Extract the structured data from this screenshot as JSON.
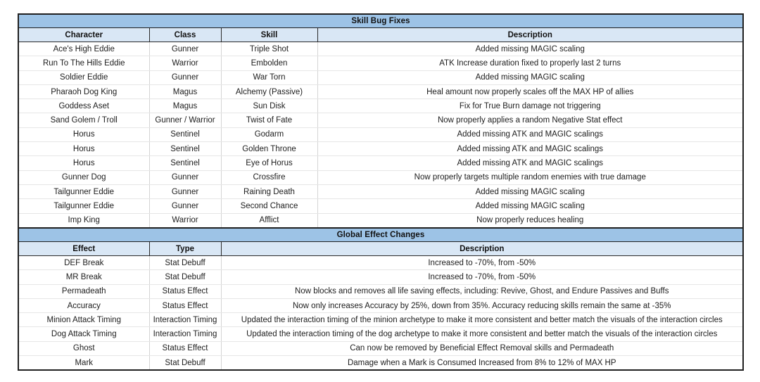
{
  "theme": {
    "title_bar_color": "#9DC3E6",
    "header_row_color": "#D9E7F5",
    "body_row_color": "#FFFFFF",
    "outer_border_color": "#202020",
    "inner_grid_color": "#D4D4D4",
    "text_color": "#202020",
    "page_background": "#FFFFFF"
  },
  "tables": [
    {
      "id": "skill-bug-fixes",
      "title": "Skill Bug Fixes",
      "columns": [
        "Character",
        "Class",
        "Skill",
        "Description"
      ],
      "rows": [
        [
          "Ace's High Eddie",
          "Gunner",
          "Triple Shot",
          "Added missing MAGIC scaling"
        ],
        [
          "Run To The Hills Eddie",
          "Warrior",
          "Embolden",
          "ATK Increase duration fixed to properly last 2 turns"
        ],
        [
          "Soldier Eddie",
          "Gunner",
          "War Torn",
          "Added missing MAGIC scaling"
        ],
        [
          "Pharaoh Dog King",
          "Magus",
          "Alchemy (Passive)",
          "Heal amount now properly scales off the MAX HP of allies"
        ],
        [
          "Goddess Aset",
          "Magus",
          "Sun Disk",
          "Fix for True Burn damage not triggering"
        ],
        [
          "Sand Golem / Troll",
          "Gunner / Warrior",
          "Twist of Fate",
          "Now properly applies a random Negative Stat effect"
        ],
        [
          "Horus",
          "Sentinel",
          "Godarm",
          "Added missing ATK and MAGIC scalings"
        ],
        [
          "Horus",
          "Sentinel",
          "Golden Throne",
          "Added missing ATK and MAGIC scalings"
        ],
        [
          "Horus",
          "Sentinel",
          "Eye of Horus",
          "Added missing ATK and MAGIC scalings"
        ],
        [
          "Gunner Dog",
          "Gunner",
          "Crossfire",
          "Now properly targets multiple random enemies with true damage"
        ],
        [
          "Tailgunner Eddie",
          "Gunner",
          "Raining Death",
          "Added missing MAGIC scaling"
        ],
        [
          "Tailgunner Eddie",
          "Gunner",
          "Second Chance",
          "Added missing MAGIC scaling"
        ],
        [
          "Imp King",
          "Warrior",
          "Afflict",
          "Now properly reduces healing"
        ]
      ]
    },
    {
      "id": "global-effect-changes",
      "title": "Global Effect Changes",
      "columns": [
        "Effect",
        "Type",
        "Description"
      ],
      "rows": [
        [
          "DEF Break",
          "Stat Debuff",
          "Increased to -70%, from -50%"
        ],
        [
          "MR Break",
          "Stat Debuff",
          "Increased to -70%, from -50%"
        ],
        [
          "Permadeath",
          "Status Effect",
          "Now blocks and removes all life saving effects, including: Revive, Ghost, and Endure Passives and Buffs"
        ],
        [
          "Accuracy",
          "Status Effect",
          "Now only increases Accuracy by 25%, down from 35%. Accuracy reducing skills remain the same at -35%"
        ],
        [
          "Minion Attack Timing",
          "Interaction Timing",
          "Updated the interaction timing of the minion archetype to make it more consistent and better match the visuals of the interaction circles"
        ],
        [
          "Dog Attack Timing",
          "Interaction Timing",
          "Updated the interaction timing of the dog archetype to make it more consistent and better match the visuals of the interaction circles"
        ],
        [
          "Ghost",
          "Status Effect",
          "Can now be removed by Beneficial Effect Removal skills and Permadeath"
        ],
        [
          "Mark",
          "Stat Debuff",
          "Damage when a Mark is Consumed Increased from 8% to 12% of MAX HP"
        ]
      ]
    }
  ]
}
